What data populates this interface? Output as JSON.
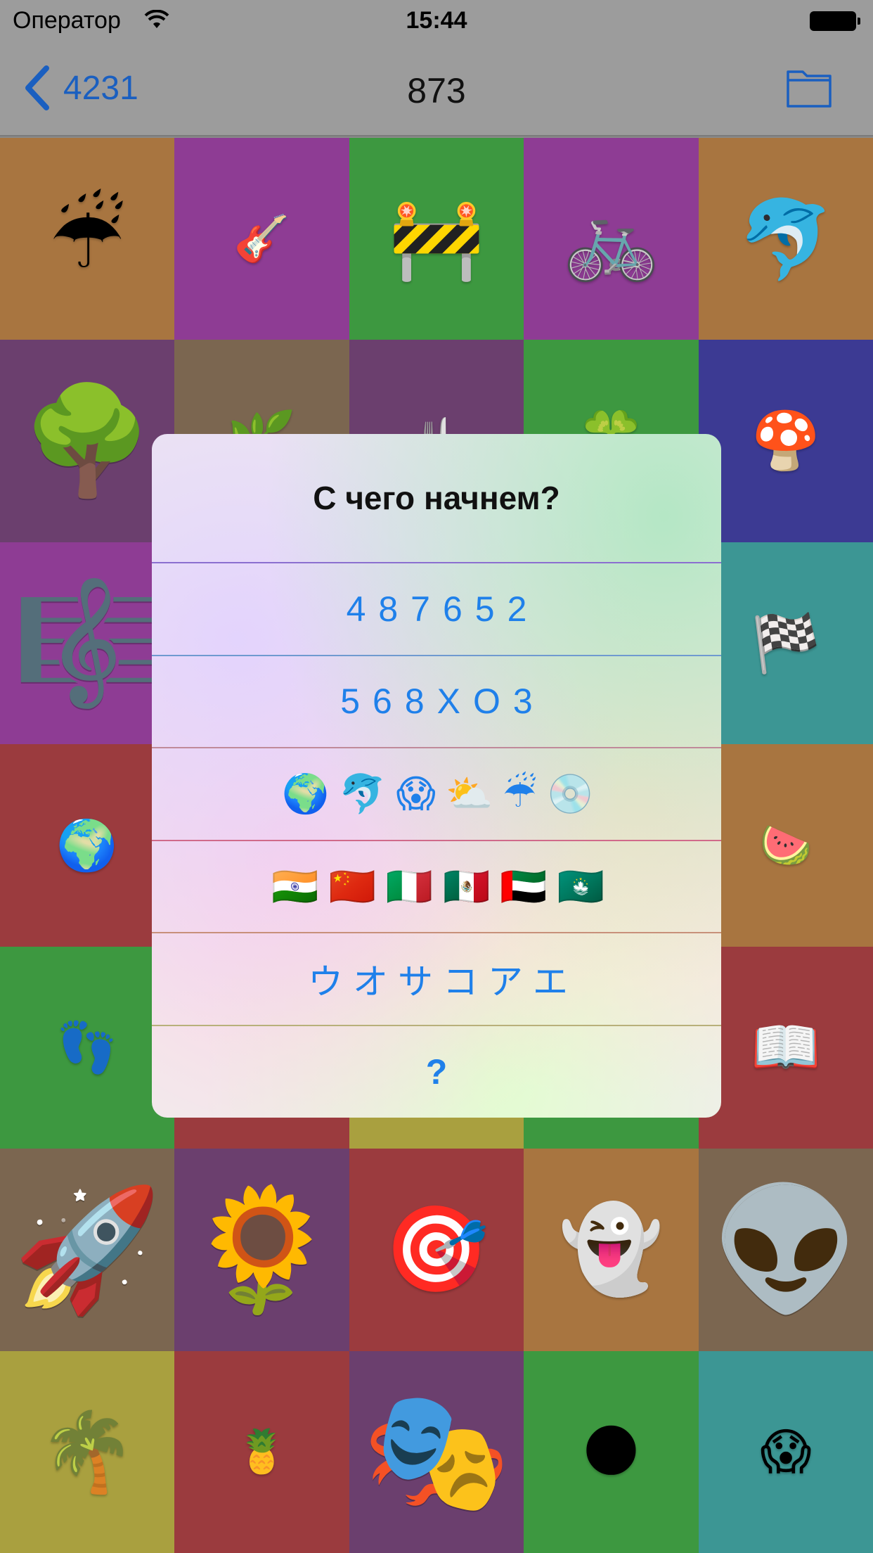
{
  "status_bar": {
    "carrier": "Оператор",
    "time": "15:44"
  },
  "nav": {
    "back_label": "4231",
    "title": "873"
  },
  "grid": {
    "cells": [
      {
        "emoji": "☔",
        "icon": "umbrella-rain-icon",
        "bg": "#a87540",
        "size": 120
      },
      {
        "emoji": "🎸",
        "icon": "guitar-icon",
        "bg": "#8e3c94",
        "size": 64
      },
      {
        "emoji": "🚧",
        "icon": "construction-barrier-icon",
        "bg": "#3d9840",
        "size": 110
      },
      {
        "emoji": "🚲",
        "icon": "bicycle-icon",
        "bg": "#8e3c94",
        "size": 110
      },
      {
        "emoji": "🐬",
        "icon": "dolphin-icon",
        "bg": "#a87540",
        "size": 110
      },
      {
        "emoji": "🌳",
        "icon": "tree-icon",
        "bg": "#6b3f6e",
        "size": 150
      },
      {
        "emoji": "🌿",
        "icon": "herb-icon",
        "bg": "#7b6650",
        "size": 80
      },
      {
        "emoji": "🍴",
        "icon": "fork-knife-icon",
        "bg": "#6b3f6e",
        "size": 60
      },
      {
        "emoji": "🍀",
        "icon": "clover-icon",
        "bg": "#3d9840",
        "size": 80
      },
      {
        "emoji": "🍄",
        "icon": "mushroom-icon",
        "bg": "#3c3a93",
        "size": 80
      },
      {
        "emoji": "🎼",
        "icon": "music-staff-icon",
        "bg": "#8e3c94",
        "size": 170
      },
      {
        "emoji": "",
        "icon": "",
        "bg": "#a87540",
        "size": 60
      },
      {
        "emoji": "",
        "icon": "",
        "bg": "#3c3a93",
        "size": 60
      },
      {
        "emoji": "",
        "icon": "",
        "bg": "#a87540",
        "size": 60
      },
      {
        "emoji": "🏁",
        "icon": "checkered-flag-icon",
        "bg": "#3c9694",
        "size": 80
      },
      {
        "emoji": "🌍",
        "icon": "globe-icon",
        "bg": "#9b3b3e",
        "size": 70
      },
      {
        "emoji": "",
        "icon": "",
        "bg": "#3c9694",
        "size": 60
      },
      {
        "emoji": "",
        "icon": "",
        "bg": "#a9a03f",
        "size": 60
      },
      {
        "emoji": "",
        "icon": "",
        "bg": "#3c9694",
        "size": 60
      },
      {
        "emoji": "🍉",
        "icon": "watermelon-icon",
        "bg": "#a87540",
        "size": 60
      },
      {
        "emoji": "👣",
        "icon": "footprints-icon",
        "bg": "#3d9840",
        "size": 70
      },
      {
        "emoji": "",
        "icon": "",
        "bg": "#9b3b3e",
        "size": 60
      },
      {
        "emoji": "",
        "icon": "",
        "bg": "#a9a03f",
        "size": 60
      },
      {
        "emoji": "",
        "icon": "",
        "bg": "#3d9840",
        "size": 60
      },
      {
        "emoji": "📖",
        "icon": "open-book-icon",
        "bg": "#9b3b3e",
        "size": 80
      },
      {
        "emoji": "🚀",
        "icon": "rocket-icon",
        "bg": "#7b6650",
        "size": 170
      },
      {
        "emoji": "🌻",
        "icon": "sunflower-icon",
        "bg": "#6b3f6e",
        "size": 170
      },
      {
        "emoji": "🎯",
        "icon": "target-icon",
        "bg": "#9b3b3e",
        "size": 120
      },
      {
        "emoji": "👻",
        "icon": "ghost-icon",
        "bg": "#a87540",
        "size": 120
      },
      {
        "emoji": "👽",
        "icon": "alien-icon",
        "bg": "#7b6650",
        "size": 170
      },
      {
        "emoji": "🌴",
        "icon": "palm-tree-icon",
        "bg": "#a9a03f",
        "size": 110
      },
      {
        "emoji": "🍍",
        "icon": "pineapple-icon",
        "bg": "#9b3b3e",
        "size": 60
      },
      {
        "emoji": "🎭",
        "icon": "theater-masks-icon",
        "bg": "#6b3f6e",
        "size": 170
      },
      {
        "emoji": "🌑",
        "icon": "new-moon-face-icon",
        "bg": "#3d9840",
        "size": 80
      },
      {
        "emoji": "😱",
        "icon": "scream-face-icon",
        "bg": "#3c9694",
        "size": 70
      }
    ]
  },
  "alert": {
    "title": "С чего начнем?",
    "options": [
      {
        "label": "487652",
        "kind": "digits"
      },
      {
        "label": "568XO3",
        "kind": "digits"
      },
      {
        "label": "🌍🐬😱⛅☔💿",
        "kind": "emoji",
        "icons": [
          "globe-icon",
          "dolphin-icon",
          "scream-face-icon",
          "sun-cloud-icon",
          "umbrella-rain-icon",
          "disc-icon"
        ]
      },
      {
        "label": "🇮🇳🇨🇳🇮🇹🇲🇽🇦🇪🇲🇴",
        "kind": "emoji",
        "icons": [
          "flag-india-icon",
          "flag-china-icon",
          "flag-italy-icon",
          "flag-mexico-icon",
          "flag-uae-icon",
          "flag-macau-icon"
        ]
      },
      {
        "label": "ウオサコアエ",
        "kind": "kana"
      },
      {
        "label": "?",
        "kind": "question"
      }
    ]
  }
}
